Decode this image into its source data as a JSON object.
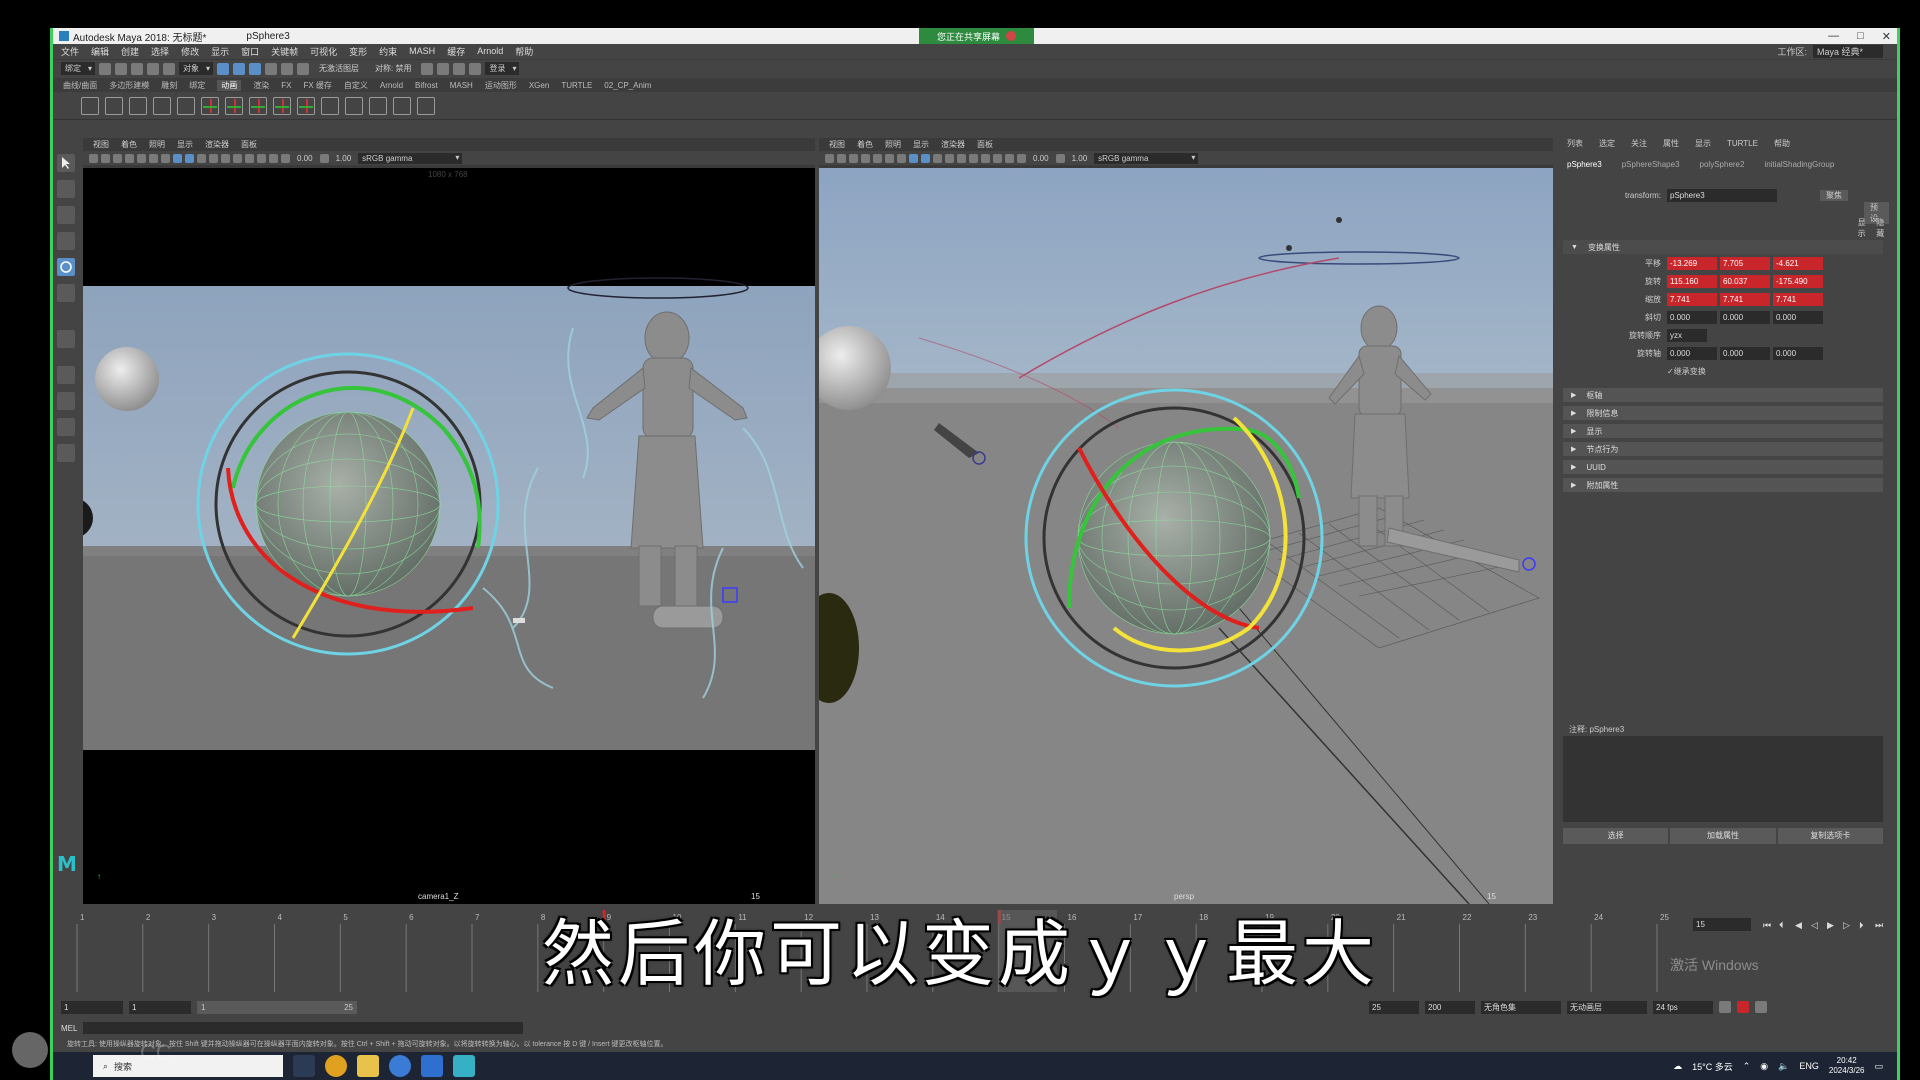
{
  "window": {
    "title": "Autodesk Maya 2018: 无标题*",
    "document": "pSphere3",
    "share_banner": "您正在共享屏幕",
    "controls": [
      "—",
      "□",
      "✕"
    ]
  },
  "menubar": {
    "items": [
      "文件",
      "编辑",
      "创建",
      "选择",
      "修改",
      "显示",
      "窗口",
      "关键帧",
      "可视化",
      "变形",
      "约束",
      "MASH",
      "缓存",
      "Arnold",
      "帮助"
    ],
    "workspace_label": "工作区:",
    "workspace_value": "Maya 经典*"
  },
  "statusline": {
    "mode": "绑定",
    "object_mode": "对象",
    "symmetry": "无激活图层",
    "snap": "对称: 禁用",
    "login": "登录"
  },
  "shelf": {
    "tabs": [
      "曲线/曲面",
      "多边形建模",
      "雕刻",
      "绑定",
      "动画",
      "渲染",
      "FX",
      "FX 缓存",
      "自定义",
      "Arnold",
      "Bifrost",
      "MASH",
      "运动图形",
      "XGen",
      "TURTLE",
      "02_CP_Anim"
    ],
    "active_tab": "动画"
  },
  "viewport_left": {
    "menu": [
      "视图",
      "着色",
      "照明",
      "显示",
      "渲染器",
      "面板"
    ],
    "num1": "0.00",
    "num2": "1.00",
    "colorspace": "sRGB gamma",
    "camera_label": "camera1_Z",
    "frame": "15",
    "res_label": "1080 x 768"
  },
  "viewport_right": {
    "menu": [
      "视图",
      "着色",
      "照明",
      "显示",
      "渲染器",
      "面板"
    ],
    "num1": "0.00",
    "num2": "1.00",
    "colorspace": "sRGB gamma",
    "camera_label": "persp",
    "frame": "15"
  },
  "channel_box": {
    "tabs": [
      "列表",
      "选定",
      "关注",
      "属性",
      "显示",
      "TURTLE",
      "帮助"
    ],
    "nodes": [
      "pSphere3",
      "pSphereShape3",
      "polySphere2",
      "initialShadingGroup"
    ],
    "transform_label": "transform:",
    "transform_value": "pSphere3",
    "focus_btn": "聚焦",
    "preset_btn": "预设",
    "show_btn": "显示",
    "hide_btn": "隐藏",
    "section_transform": "变换属性",
    "rows": [
      {
        "label": "平移",
        "values": [
          "-13.269",
          "7.705",
          "-4.621"
        ],
        "keyed": true
      },
      {
        "label": "旋转",
        "values": [
          "115.160",
          "60.037",
          "-175.490"
        ],
        "keyed": true
      },
      {
        "label": "缩放",
        "values": [
          "7.741",
          "7.741",
          "7.741"
        ],
        "keyed": true
      },
      {
        "label": "斜切",
        "values": [
          "0.000",
          "0.000",
          "0.000"
        ],
        "keyed": false
      }
    ],
    "rotate_order_label": "旋转顺序",
    "rotate_order": "yzx",
    "rotate_axis_label": "旋转轴",
    "rotate_axis": [
      "0.000",
      "0.000",
      "0.000"
    ],
    "inherit_label": "继承变换",
    "sections": [
      "枢轴",
      "限制信息",
      "显示",
      "节点行为",
      "UUID",
      "附加属性"
    ],
    "notes_label": "注释: pSphere3",
    "buttons": [
      "选择",
      "加载属性",
      "复制选项卡"
    ]
  },
  "timeline": {
    "ticks": [
      "1",
      "2",
      "3",
      "4",
      "5",
      "6",
      "7",
      "8",
      "9",
      "10",
      "11",
      "12",
      "13",
      "14",
      "15",
      "16",
      "17",
      "18",
      "19",
      "20",
      "21",
      "22",
      "23",
      "24",
      "25"
    ],
    "current_frame": "15",
    "range_start": "1",
    "range_inner_start": "1",
    "slider_start": "1",
    "slider_end": "25",
    "range_end": "25",
    "anim_end": "200",
    "char_set": "无角色集",
    "anim_layer": "无动画层",
    "fps": "24 fps",
    "keys": [
      9,
      15
    ]
  },
  "command": {
    "mel": "MEL",
    "help": "旋转工具: 使用操纵器旋转对象。按住 Shift 键并拖动操纵器可在操纵器平面内旋转对象。按住 Ctrl + Shift + 拖动可旋转对象。以将旋转转换为轴心。以 tolerance 按 D 键 / Insert 键更改枢轴位置。"
  },
  "taskbar": {
    "search": "搜索",
    "weather": "15°C 多云",
    "lang": "ENG",
    "time": "20:42",
    "date": "2024/3/26"
  },
  "watermark": "激活 Windows",
  "subtitle": "然后你可以变成ｙｙ最大",
  "faded_text": "CC"
}
